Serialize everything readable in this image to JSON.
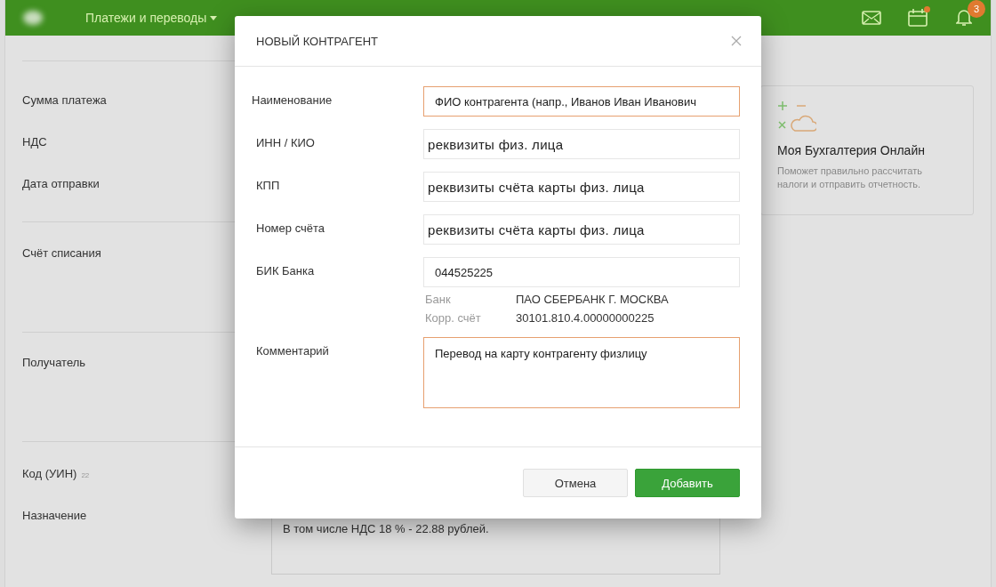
{
  "top_bar": {
    "nav": [
      {
        "label": "Платежи и переводы",
        "selected": true
      }
    ],
    "notifications_badge": "3",
    "calendar_dot": true
  },
  "payment_form": {
    "sections": [
      {
        "labels": [
          "Сумма платежа",
          "НДС",
          "Дата отправки"
        ]
      },
      {
        "labels": [
          "Счёт списания"
        ]
      },
      {
        "labels": [
          "Получатель"
        ]
      },
      {
        "labels": [
          "Код (УИН)",
          "Назначение"
        ],
        "code_hint": "22"
      }
    ],
    "purpose_text": "В том числе НДС 18 % - 22.88 рублей."
  },
  "promo_card": {
    "title": "Моя Бухгалтерия Онлайн",
    "text": "Поможет правильно рассчитать налоги и отправить отчетность."
  },
  "dialog": {
    "title": "НОВЫЙ КОНТРАГЕНТ",
    "fields": [
      {
        "label": "Наименование",
        "value": "ФИО контрагента (напр., Иванов Иван Иванович",
        "highlighted": true,
        "kind": "input"
      },
      {
        "label": "ИНН / КИО",
        "value": "реквизиты физ. лица",
        "highlighted": false,
        "kind": "large-input"
      },
      {
        "label": "КПП",
        "value": "реквизиты счёта карты физ. лица",
        "highlighted": false,
        "kind": "large-input"
      },
      {
        "label": "Номер счёта",
        "value": "реквизиты счёта карты физ. лица",
        "highlighted": false,
        "kind": "large-input"
      },
      {
        "label": "БИК Банка",
        "value": "044525225",
        "highlighted": false,
        "kind": "input",
        "details": [
          {
            "label": "Банк",
            "value": "ПАО СБЕРБАНК Г. МОСКВА"
          },
          {
            "label": "Корр. счёт",
            "value": "30101.810.4.00000000225"
          }
        ]
      },
      {
        "label": "Комментарий",
        "value": "Перевод на карту контрагенту физлицу",
        "highlighted": true,
        "kind": "textarea"
      }
    ],
    "buttons": [
      {
        "label": "Отмена",
        "primary": false
      },
      {
        "label": "Добавить",
        "primary": true
      }
    ]
  }
}
